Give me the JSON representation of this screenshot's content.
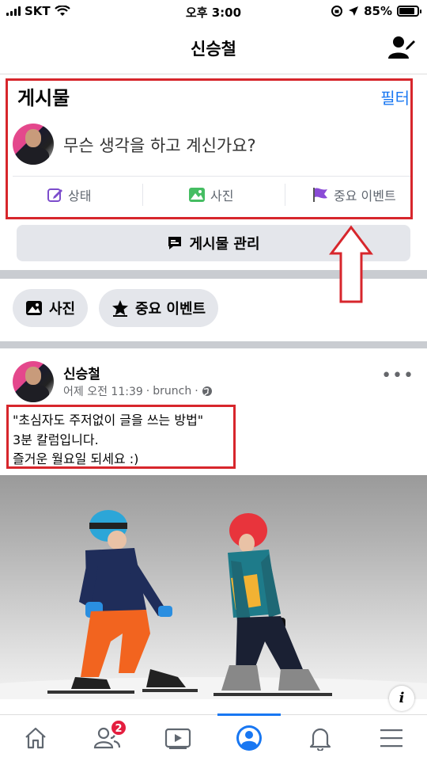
{
  "status_bar": {
    "carrier": "SKT",
    "time": "오후 3:00",
    "battery": "85%"
  },
  "header": {
    "title": "신승철",
    "right_icon": "user-edit-icon"
  },
  "composer": {
    "section_title": "게시물",
    "filter_label": "필터",
    "prompt": "무슨 생각을 하고 계신가요?",
    "actions": [
      {
        "label": "상태",
        "icon": "edit-icon",
        "color": "#7c4dcc"
      },
      {
        "label": "사진",
        "icon": "photo-icon",
        "color": "#45bd62"
      },
      {
        "label": "중요 이벤트",
        "icon": "flag-icon",
        "color": "#8a4bd6"
      }
    ]
  },
  "manage_button": {
    "label": "게시물 관리",
    "icon": "message-icon"
  },
  "chips": [
    {
      "label": "사진",
      "icon": "photo-icon"
    },
    {
      "label": "중요 이벤트",
      "icon": "star-icon"
    }
  ],
  "post": {
    "author": "신승철",
    "time": "어제 오전 11:39",
    "source": "brunch",
    "privacy_icon": "globe-icon",
    "lines": [
      "\"초심자도 주저없이 글을 쓰는 방법\"",
      "3분 칼럼입니다.",
      "즐거운 월요일 되세요 :)"
    ]
  },
  "tab_bar": {
    "items": [
      {
        "name": "home",
        "icon": "home-icon"
      },
      {
        "name": "friends",
        "icon": "friends-icon",
        "badge": "2"
      },
      {
        "name": "watch",
        "icon": "video-icon"
      },
      {
        "name": "profile",
        "icon": "profile-icon",
        "active": true
      },
      {
        "name": "notifications",
        "icon": "bell-icon"
      },
      {
        "name": "menu",
        "icon": "menu-icon"
      }
    ]
  },
  "colors": {
    "accent": "#1877f2",
    "highlight": "#d7262c",
    "badge": "#e41e3f"
  }
}
